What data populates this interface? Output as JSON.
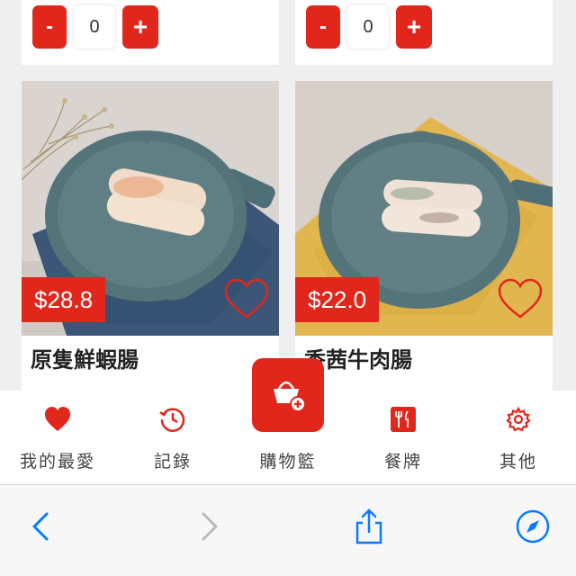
{
  "steppers": [
    {
      "minus_label": "-",
      "quantity": "0",
      "plus_label": "+"
    },
    {
      "minus_label": "-",
      "quantity": "0",
      "plus_label": "+"
    }
  ],
  "products": [
    {
      "price": "$28.8",
      "name": "原隻鮮蝦腸",
      "favorite_icon": "heart-outline-icon"
    },
    {
      "price": "$22.0",
      "name": "香茜牛肉腸",
      "favorite_icon": "heart-outline-icon"
    }
  ],
  "tabbar": {
    "items": [
      {
        "label": "我的最愛",
        "icon": "heart-icon"
      },
      {
        "label": "記錄",
        "icon": "history-clock-icon"
      },
      {
        "label": "購物籃",
        "icon": "basket-add-icon"
      },
      {
        "label": "餐牌",
        "icon": "menu-cutlery-icon"
      },
      {
        "label": "其他",
        "icon": "gear-icon"
      }
    ]
  },
  "browser": {
    "icons": [
      "back-chevron-icon",
      "forward-chevron-icon",
      "share-icon",
      "compass-icon"
    ]
  },
  "colors": {
    "accent": "#e1261c",
    "safari_blue": "#0a7aff"
  }
}
